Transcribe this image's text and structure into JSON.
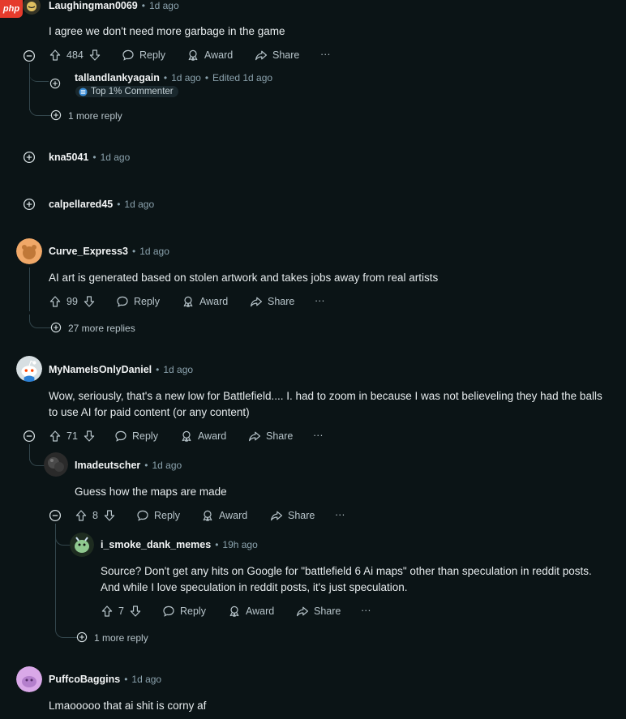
{
  "watermark": "php",
  "comments": [
    {
      "author": "Laughingman0069",
      "age": "1d ago",
      "text": "I agree we don't need more garbage in the game",
      "votes": "484"
    },
    {
      "author": "tallandlankyagain",
      "age": "1d ago",
      "edited": "Edited 1d ago",
      "flair": "Top 1% Commenter"
    },
    {
      "author": "kna5041",
      "age": "1d ago"
    },
    {
      "author": "calpellared45",
      "age": "1d ago"
    },
    {
      "author": "Curve_Express3",
      "age": "1d ago",
      "text": "AI art is generated based on stolen artwork and takes jobs away from real artists",
      "votes": "99"
    },
    {
      "author": "MyNameIsOnlyDaniel",
      "age": "1d ago",
      "text": "Wow, seriously, that's a new low for Battlefield.... I. had to zoom in because I was not believeling they had the balls to use AI for paid content (or any content)",
      "votes": "71"
    },
    {
      "author": "Imadeutscher",
      "age": "1d ago",
      "text": "Guess how the maps are made",
      "votes": "8"
    },
    {
      "author": "i_smoke_dank_memes",
      "age": "19h ago",
      "text": "Source? Don't get any hits on Google for \"battlefield 6 Ai maps\" other than speculation in reddit posts. And while I love speculation in reddit posts, it's just speculation.",
      "votes": "7"
    },
    {
      "author": "PuffcoBaggins",
      "age": "1d ago",
      "text": "Lmaooooo that ai shit is corny af"
    }
  ],
  "actions": {
    "reply": "Reply",
    "award": "Award",
    "share": "Share",
    "overflow": "···"
  },
  "more_replies": {
    "one": "1 more reply",
    "curve": "27 more replies",
    "smoke": "1 more reply"
  },
  "colors": {
    "background": "#0b1416",
    "text": "#f2f4f5",
    "muted": "#8ba2ad",
    "thread": "#33464c"
  }
}
